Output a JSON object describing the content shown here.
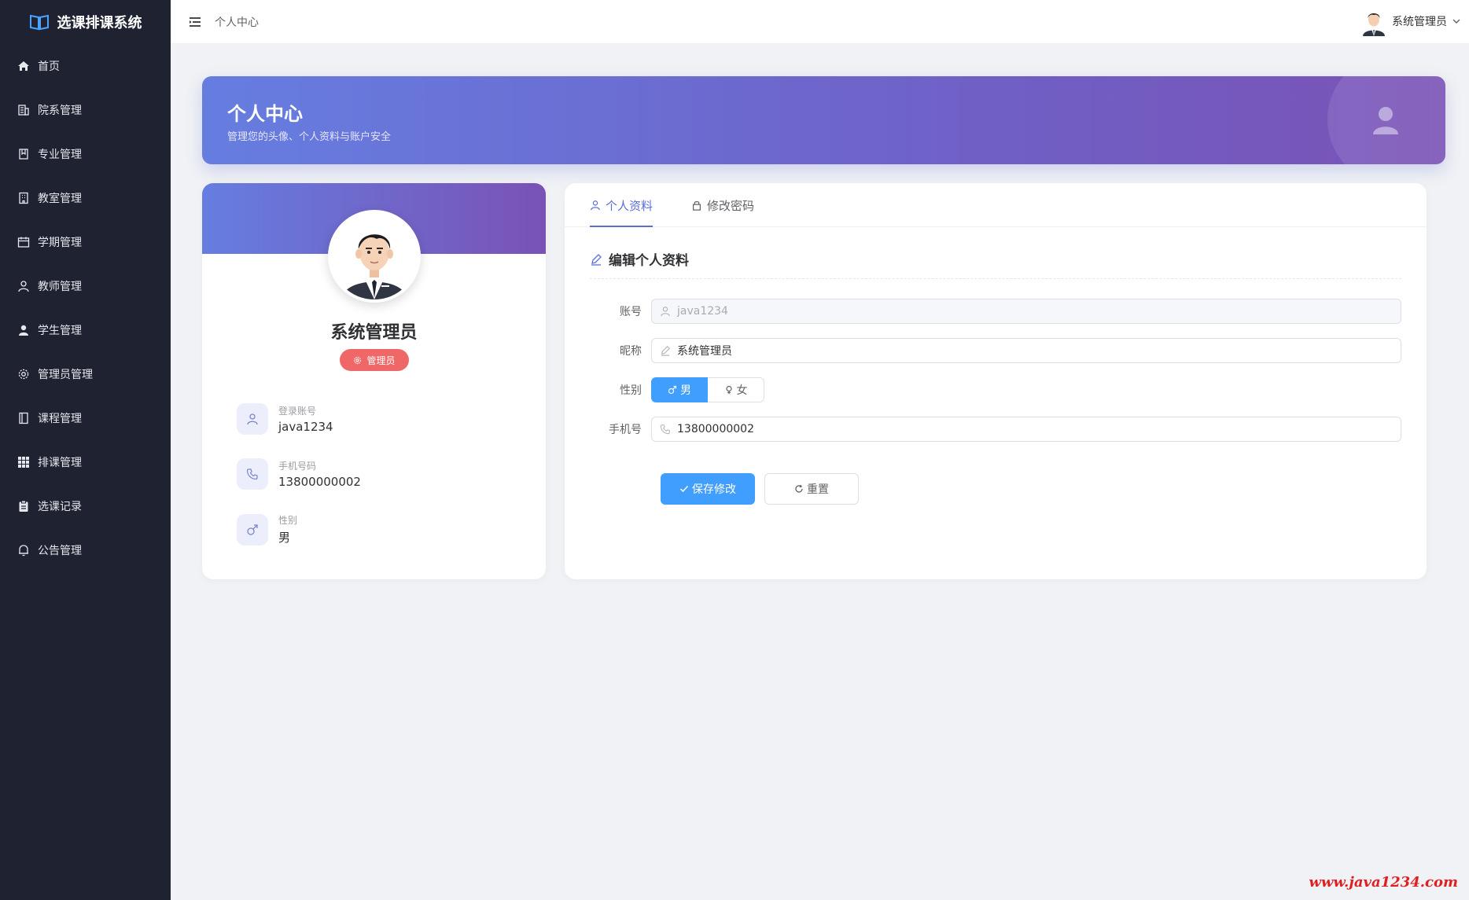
{
  "app": {
    "title": "选课排课系统",
    "icon": "book-icon"
  },
  "sidebar": {
    "items": [
      {
        "label": "首页",
        "icon": "home-icon"
      },
      {
        "label": "院系管理",
        "icon": "building-icon"
      },
      {
        "label": "专业管理",
        "icon": "bookmark-icon"
      },
      {
        "label": "教室管理",
        "icon": "office-icon"
      },
      {
        "label": "学期管理",
        "icon": "calendar-icon"
      },
      {
        "label": "教师管理",
        "icon": "user-outline-icon"
      },
      {
        "label": "学生管理",
        "icon": "user-filled-icon"
      },
      {
        "label": "管理员管理",
        "icon": "gear-icon"
      },
      {
        "label": "课程管理",
        "icon": "notebook-icon"
      },
      {
        "label": "排课管理",
        "icon": "grid-icon"
      },
      {
        "label": "选课记录",
        "icon": "clipboard-icon"
      },
      {
        "label": "公告管理",
        "icon": "bell-icon"
      }
    ]
  },
  "header": {
    "breadcrumb": "个人中心",
    "user_name": "系统管理员"
  },
  "banner": {
    "title": "个人中心",
    "subtitle": "管理您的头像、个人资料与账户安全"
  },
  "profile": {
    "name": "系统管理员",
    "role": "管理员",
    "info": [
      {
        "label": "登录账号",
        "value": "java1234",
        "icon": "user-icon"
      },
      {
        "label": "手机号码",
        "value": "13800000002",
        "icon": "phone-icon"
      },
      {
        "label": "性别",
        "value": "男",
        "icon": "male-icon"
      }
    ]
  },
  "tabs": [
    {
      "label": "个人资料",
      "icon": "user-icon",
      "active": true
    },
    {
      "label": "修改密码",
      "icon": "lock-icon",
      "active": false
    }
  ],
  "form": {
    "section_title": "编辑个人资料",
    "account_label": "账号",
    "account_value": "java1234",
    "nickname_label": "昵称",
    "nickname_value": "系统管理员",
    "gender_label": "性别",
    "gender_male": "男",
    "gender_female": "女",
    "gender_selected": "男",
    "phone_label": "手机号",
    "phone_value": "13800000002",
    "save_label": "保存修改",
    "reset_label": "重置"
  },
  "watermark": "www.java1234.com",
  "colors": {
    "sidebar_bg": "#1f2230",
    "primary": "#409eff",
    "banner_start": "#667de0",
    "banner_end": "#7a52b6",
    "role_badge": "#f06767"
  }
}
